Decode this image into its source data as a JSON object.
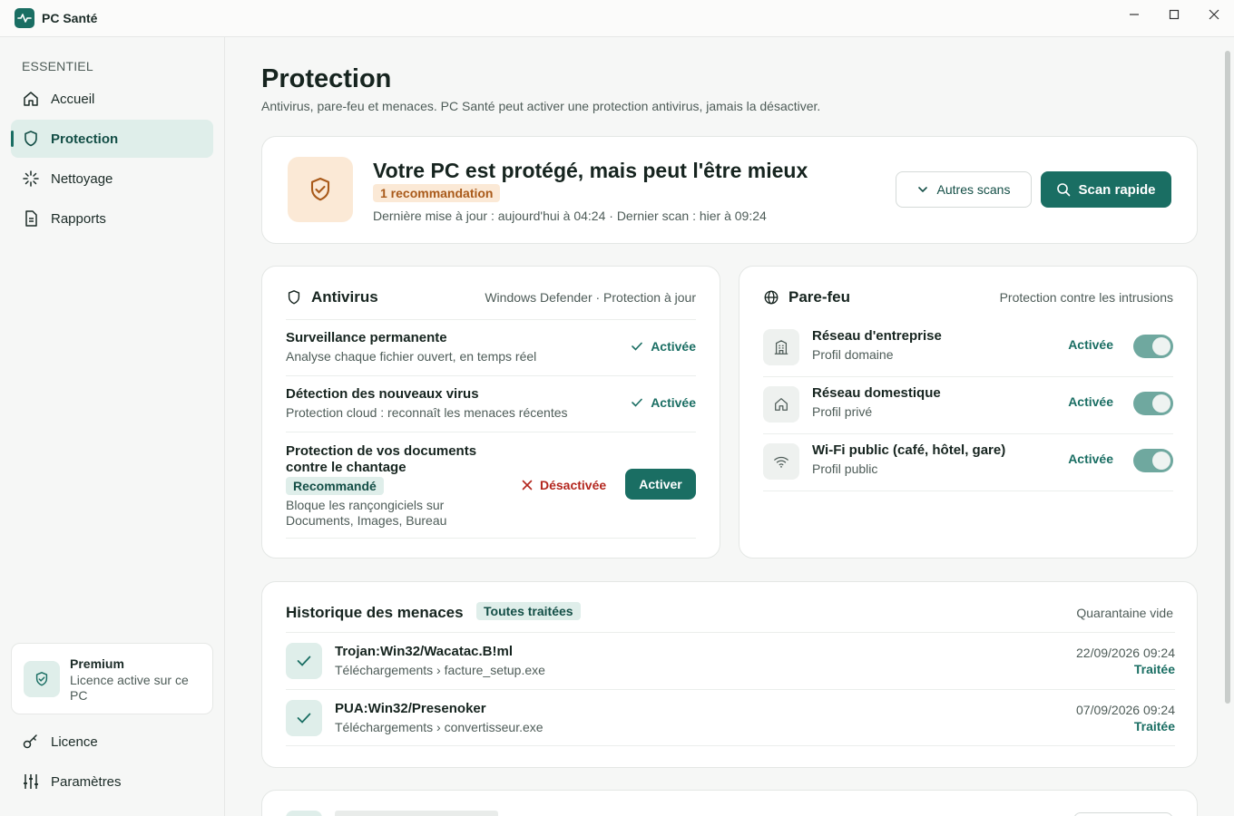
{
  "app": {
    "title": "PC Santé"
  },
  "sidebar": {
    "section": "ESSENTIEL",
    "items": [
      {
        "label": "Accueil",
        "icon": "home-icon"
      },
      {
        "label": "Protection",
        "icon": "shield-icon",
        "active": true
      },
      {
        "label": "Nettoyage",
        "icon": "sparkle-icon"
      },
      {
        "label": "Rapports",
        "icon": "document-icon"
      }
    ],
    "premium": {
      "title": "Premium",
      "subtitle": "Licence active sur ce PC"
    },
    "bottom": [
      {
        "label": "Licence",
        "icon": "key-icon"
      },
      {
        "label": "Paramètres",
        "icon": "sliders-icon"
      }
    ]
  },
  "page": {
    "title": "Protection",
    "subtitle": "Antivirus, pare-feu et menaces. PC Santé peut activer une protection antivirus, jamais la désactiver."
  },
  "status": {
    "title": "Votre PC est protégé, mais peut l'être mieux",
    "badge": "1 recommandation",
    "meta": "Dernière mise à jour : aujourd'hui à 04:24 · Dernier scan : hier à 09:24",
    "other_scans_label": "Autres scans",
    "quick_scan_label": "Scan rapide"
  },
  "antivirus": {
    "title": "Antivirus",
    "meta": "Windows Defender · Protection à jour",
    "rows": [
      {
        "title": "Surveillance permanente",
        "subtitle": "Analyse chaque fichier ouvert, en temps réel",
        "state": "Activée"
      },
      {
        "title": "Détection des nouveaux virus",
        "subtitle": "Protection cloud : reconnaît les menaces récentes",
        "state": "Activée"
      }
    ],
    "ransomware": {
      "title_line1": "Protection de vos documents",
      "title_line2": "contre le chantage",
      "badge": "Recommandé",
      "subtitle_line1": "Bloque les rançongiciels sur",
      "subtitle_line2": "Documents, Images, Bureau",
      "state": "Désactivée",
      "action_label": "Activer"
    }
  },
  "firewall": {
    "title": "Pare-feu",
    "meta": "Protection contre les intrusions",
    "rows": [
      {
        "title": "Réseau d'entreprise",
        "subtitle": "Profil domaine",
        "state": "Activée",
        "icon": "building-icon",
        "on": true
      },
      {
        "title": "Réseau domestique",
        "subtitle": "Profil privé",
        "state": "Activée",
        "icon": "home-icon",
        "on": true
      },
      {
        "title": "Wi-Fi public (café, hôtel, gare)",
        "subtitle": "Profil public",
        "state": "Activée",
        "icon": "wifi-icon",
        "on": true
      }
    ]
  },
  "history": {
    "title": "Historique des menaces",
    "badge": "Toutes traitées",
    "meta": "Quarantaine vide",
    "rows": [
      {
        "name": "Trojan:Win32/Wacatac.B!ml",
        "path": "Téléchargements › facture_setup.exe",
        "date": "22/09/2026 09:24",
        "state": "Traitée"
      },
      {
        "name": "PUA:Win32/Presenoker",
        "path": "Téléchargements › convertisseur.exe",
        "date": "07/09/2026 09:24",
        "state": "Traitée"
      }
    ]
  },
  "colors": {
    "accent": "#1a6e63",
    "warning": "#a95a1a",
    "danger": "#b3261e"
  }
}
